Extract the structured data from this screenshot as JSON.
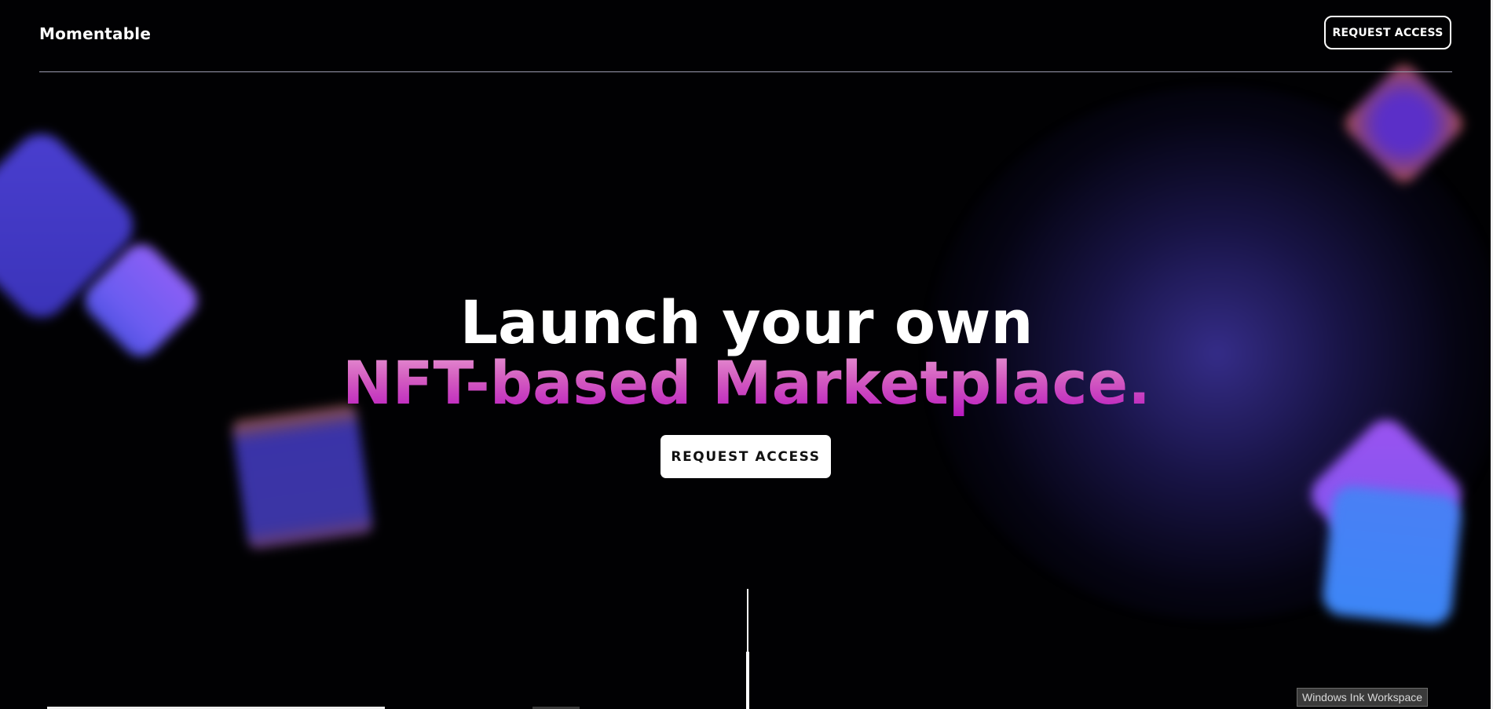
{
  "header": {
    "logo_text": "Momentable",
    "cta_label": "REQUEST ACCESS"
  },
  "hero": {
    "title_line1": "Launch your own",
    "title_line2": "NFT-based Marketplace.",
    "cta_label": "REQUEST ACCESS"
  },
  "tooltip": {
    "text": "Windows Ink Workspace"
  },
  "colors": {
    "background": "#010103",
    "accent_gradient_top": "#e99ad4",
    "accent_gradient_bottom": "#b817c0",
    "button_bg": "#ffffff",
    "glow": "#3e34a0"
  }
}
